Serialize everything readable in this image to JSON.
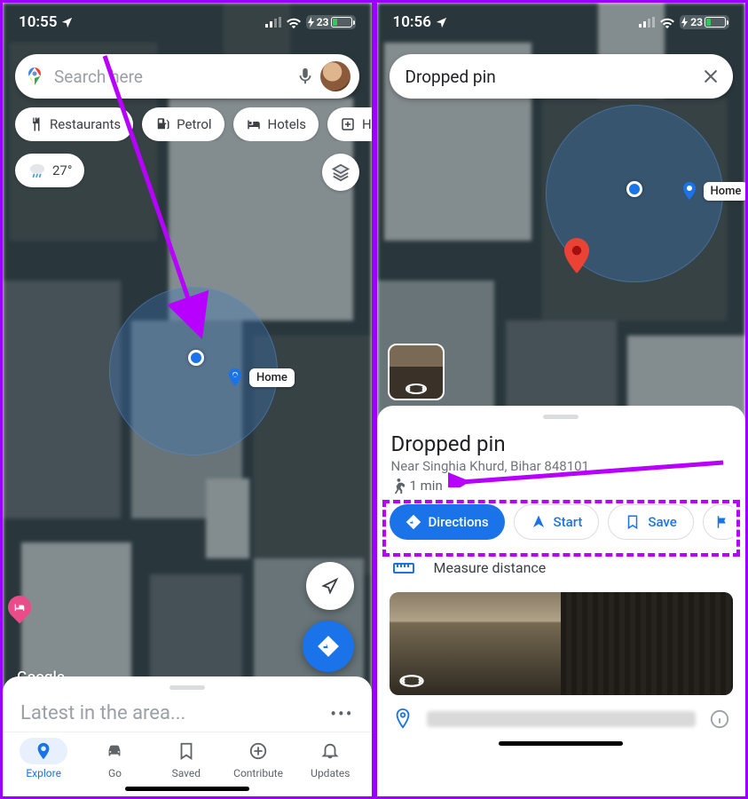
{
  "left": {
    "status": {
      "time": "10:55",
      "battery": "23"
    },
    "search": {
      "placeholder": "Search here"
    },
    "chips": {
      "restaurants": "Restaurants",
      "petrol": "Petrol",
      "hotels": "Hotels",
      "hospitals": "Hospitals"
    },
    "weather": "27°",
    "home_label": "Home",
    "watermark": "Google",
    "sheet_title": "Latest in the area...",
    "tabs": {
      "explore": "Explore",
      "go": "Go",
      "saved": "Saved",
      "contribute": "Contribute",
      "updates": "Updates"
    }
  },
  "right": {
    "status": {
      "time": "10:56",
      "battery": "23"
    },
    "search": {
      "value": "Dropped pin"
    },
    "home_label": "Home",
    "card": {
      "title": "Dropped pin",
      "subtitle": "Near Singhia Khurd, Bihar 848101",
      "walk_time": "1 min",
      "directions": "Directions",
      "start": "Start",
      "save": "Save",
      "measure": "Measure distance"
    }
  }
}
